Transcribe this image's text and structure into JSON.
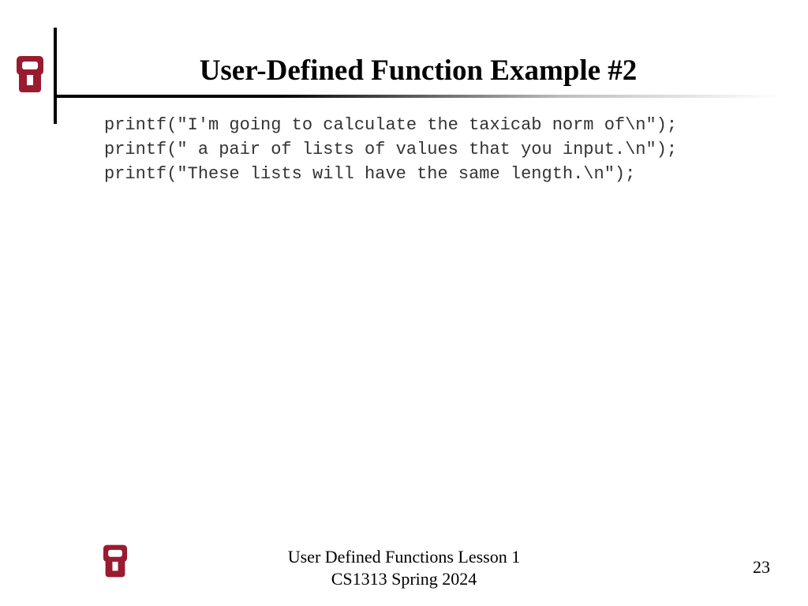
{
  "header": {
    "title": "User-Defined Function Example #2"
  },
  "code": {
    "lines": [
      "printf(\"I'm going to calculate the taxicab norm of\\n\");",
      "printf(\" a pair of lists of values that you input.\\n\");",
      "printf(\"These lists will have the same length.\\n\");"
    ]
  },
  "footer": {
    "line1": "User Defined Functions Lesson 1",
    "line2": "CS1313 Spring 2024",
    "page": "23"
  },
  "brand": {
    "color": "#9a1b2f"
  }
}
